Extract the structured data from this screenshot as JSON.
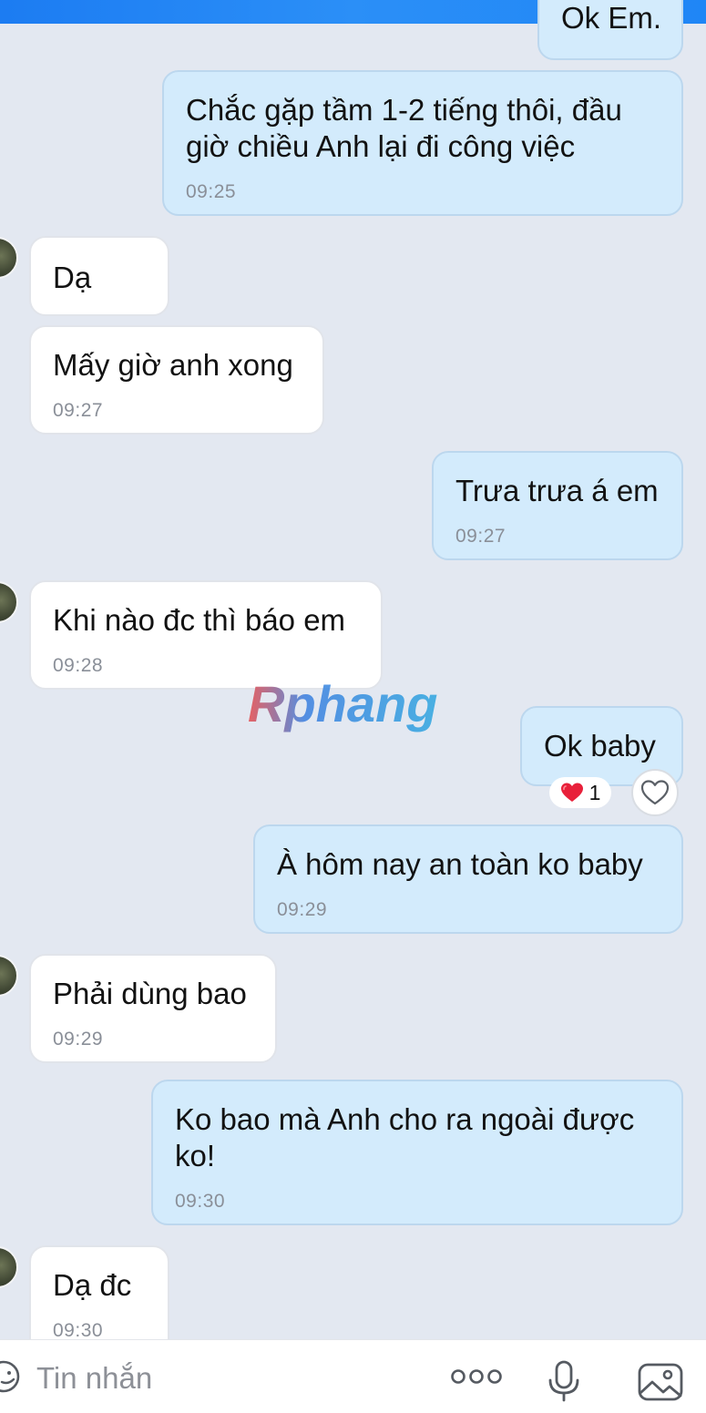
{
  "messages": [
    {
      "dir": "out",
      "text": "Ok Em.",
      "time": ""
    },
    {
      "dir": "out",
      "text": "Chắc gặp tầm 1-2 tiếng thôi, đầu giờ chiều Anh lại đi công việc",
      "line1": "Chắc gặp tầm 1-2 tiếng thôi, đầu",
      "line2": "giờ chiều Anh lại đi công việc",
      "time": "09:25"
    },
    {
      "dir": "in",
      "text": "Dạ",
      "time": ""
    },
    {
      "dir": "in",
      "text": "Mấy giờ anh xong",
      "time": "09:27"
    },
    {
      "dir": "out",
      "text": "Trưa trưa á em",
      "time": "09:27"
    },
    {
      "dir": "in",
      "text": "Khi nào đc thì báo em",
      "time": "09:28"
    },
    {
      "dir": "out",
      "text": "Ok baby",
      "time": "",
      "reaction": {
        "emoji": "heart",
        "count": "1"
      }
    },
    {
      "dir": "out",
      "text": "À hôm nay an toàn ko baby",
      "time": "09:29"
    },
    {
      "dir": "in",
      "text": "Phải dùng bao",
      "time": "09:29"
    },
    {
      "dir": "out",
      "text": "Ko bao mà Anh cho ra ngoài được ko!",
      "line1": "Ko bao mà Anh cho ra ngoài được",
      "line2": "ko!",
      "time": "09:30"
    },
    {
      "dir": "in",
      "text": "Dạ đc",
      "time": "09:30"
    }
  ],
  "watermark": {
    "text": "Rphang"
  },
  "composer": {
    "placeholder": "Tin nhắn"
  },
  "colors": {
    "outgoing_bubble": "#d3ebfc",
    "incoming_bubble": "#ffffff",
    "background": "#e3e8f1",
    "header": "#1c7cf2",
    "reaction_heart": "#e8203a"
  },
  "icons": [
    "emoji-icon",
    "more-options-icon",
    "microphone-icon",
    "image-icon",
    "heart-like-icon"
  ]
}
